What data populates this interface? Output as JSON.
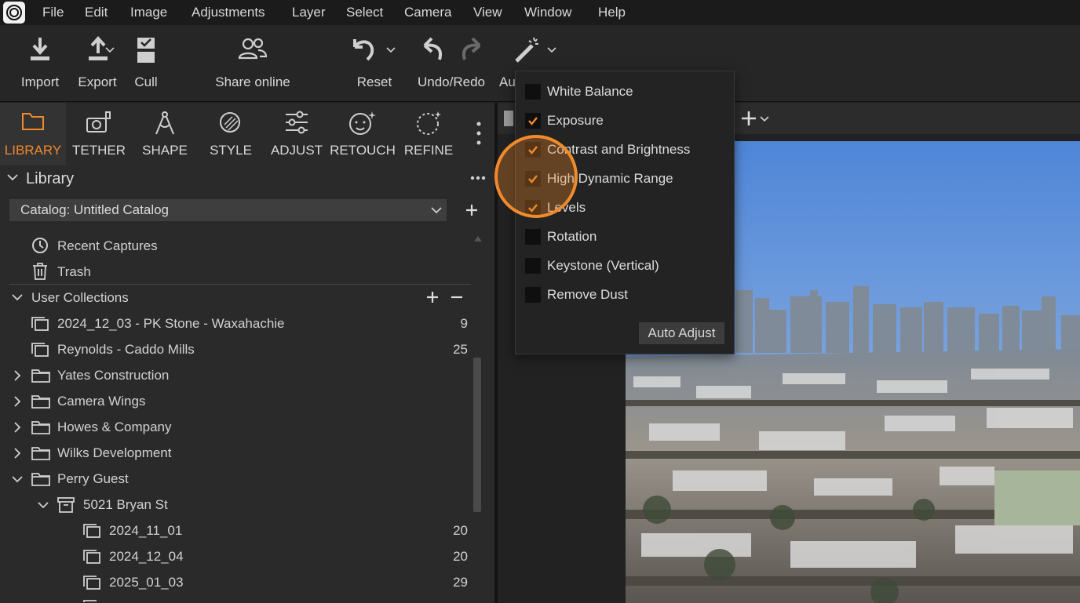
{
  "menubar": {
    "items": [
      "File",
      "Edit",
      "Image",
      "Adjustments",
      "Layer",
      "Select",
      "Camera",
      "View",
      "Window",
      "Help"
    ]
  },
  "toolbar": {
    "import": "Import",
    "export": "Export",
    "cull": "Cull",
    "share_online": "Share online",
    "reset": "Reset",
    "undo_redo": "Undo/Redo",
    "auto": "Au"
  },
  "tool_tabs": [
    "LIBRARY",
    "TETHER",
    "SHAPE",
    "STYLE",
    "ADJUST",
    "RETOUCH",
    "REFINE"
  ],
  "library": {
    "title": "Library",
    "catalog": "Catalog: Untitled Catalog",
    "recent_captures": "Recent Captures",
    "trash": "Trash",
    "user_collections": "User Collections",
    "albums": [
      {
        "name": "2024_12_03 - PK Stone - Waxahachie",
        "count": "9"
      },
      {
        "name": "Reynolds - Caddo Mills",
        "count": "25"
      }
    ],
    "groups": [
      "Yates Construction",
      "Camera Wings",
      "Howes & Company",
      "Wilks Development",
      "Perry Guest"
    ],
    "project": "5021 Bryan St",
    "project_albums": [
      {
        "name": "2024_11_01",
        "count": "20"
      },
      {
        "name": "2024_12_04",
        "count": "20"
      },
      {
        "name": "2025_01_03",
        "count": "29"
      }
    ]
  },
  "auto_menu": {
    "options": [
      {
        "label": "White Balance",
        "checked": false
      },
      {
        "label": "Exposure",
        "checked": true
      },
      {
        "label": "Contrast and Brightness",
        "checked": true
      },
      {
        "label": "High Dynamic Range",
        "checked": true
      },
      {
        "label": "Levels",
        "checked": true
      },
      {
        "label": "Rotation",
        "checked": false
      },
      {
        "label": "Keystone (Vertical)",
        "checked": false
      },
      {
        "label": "Remove Dust",
        "checked": false
      }
    ],
    "button": "Auto Adjust"
  },
  "colors": {
    "accent": "#f08a2c",
    "panel": "#2a2a2a",
    "sky": "#5d8fd6"
  }
}
